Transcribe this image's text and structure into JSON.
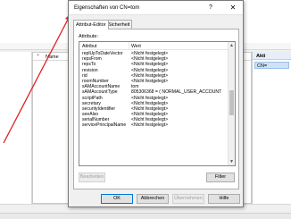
{
  "background": {
    "tree_header": "Name",
    "actions_header": "Akti",
    "actions_selected": "CN="
  },
  "dialog": {
    "title": "Eigenschaften von CN=tom",
    "help_glyph": "?",
    "close_glyph": "✕",
    "tabs": [
      {
        "label": "Attribut-Editor",
        "active": true
      },
      {
        "label": "Sicherheit",
        "active": false
      }
    ],
    "attributes_label": "Attribute:",
    "columns": {
      "attribute": "Attribut",
      "value": "Wert"
    },
    "rows": [
      {
        "name": "replUpToDateVector",
        "value": "<Nicht festgelegt>"
      },
      {
        "name": "repsFrom",
        "value": "<Nicht festgelegt>"
      },
      {
        "name": "repsTo",
        "value": "<Nicht festgelegt>"
      },
      {
        "name": "revision",
        "value": "<Nicht festgelegt>"
      },
      {
        "name": "rid",
        "value": "<Nicht festgelegt>"
      },
      {
        "name": "roomNumber",
        "value": "<Nicht festgelegt>"
      },
      {
        "name": "sAMAccountName",
        "value": "tom"
      },
      {
        "name": "sAMAccountType",
        "value": "805306368 = ( NORMAL_USER_ACCOUNT"
      },
      {
        "name": "scriptPath",
        "value": "<Nicht festgelegt>"
      },
      {
        "name": "secretary",
        "value": "<Nicht festgelegt>"
      },
      {
        "name": "securityIdentifier",
        "value": "<Nicht festgelegt>"
      },
      {
        "name": "seeAlso",
        "value": "<Nicht festgelegt>"
      },
      {
        "name": "serialNumber",
        "value": "<Nicht festgelegt>"
      },
      {
        "name": "servicePrincipalName",
        "value": "<Nicht festgelegt>"
      }
    ],
    "edit_button": "Bearbeiten",
    "filter_button": "Filter",
    "ok_button": "OK",
    "cancel_button": "Abbrechen",
    "apply_button": "Übernehmen",
    "help_button": "Hilfe"
  }
}
